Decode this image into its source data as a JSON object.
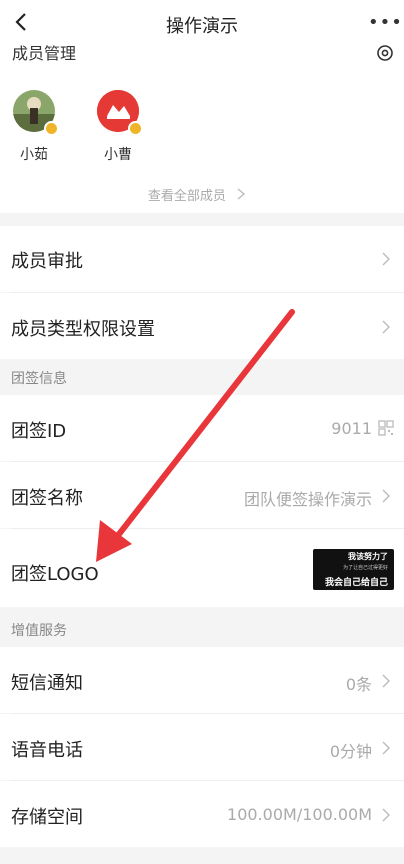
{
  "nav": {
    "title": "操作演示",
    "more_label": "•••"
  },
  "members_section": {
    "title": "成员管理",
    "members": [
      {
        "name": "小茹"
      },
      {
        "name": "小曹"
      }
    ],
    "view_all_label": "查看全部成员"
  },
  "rows_a": [
    {
      "label": "成员审批"
    },
    {
      "label": "成员类型权限设置"
    }
  ],
  "group_info": {
    "title": "团签信息",
    "id_label": "团签ID",
    "id_value": "9011",
    "name_label": "团签名称",
    "name_value": "团队便签操作演示",
    "logo_label": "团签LOGO",
    "logo_text": {
      "line1": "我该努力了",
      "line2": "为了让自己过得更好",
      "line3": "我会自己给自己"
    }
  },
  "group_vas": {
    "title": "增值服务",
    "sms_label": "短信通知",
    "sms_value": "0条",
    "voice_label": "语音电话",
    "voice_value": "0分钟",
    "storage_label": "存储空间",
    "storage_value": "100.00M/100.00M"
  },
  "colors": {
    "accent": "#e53935",
    "badge": "#f0b429",
    "arrow": "#e8363a"
  }
}
